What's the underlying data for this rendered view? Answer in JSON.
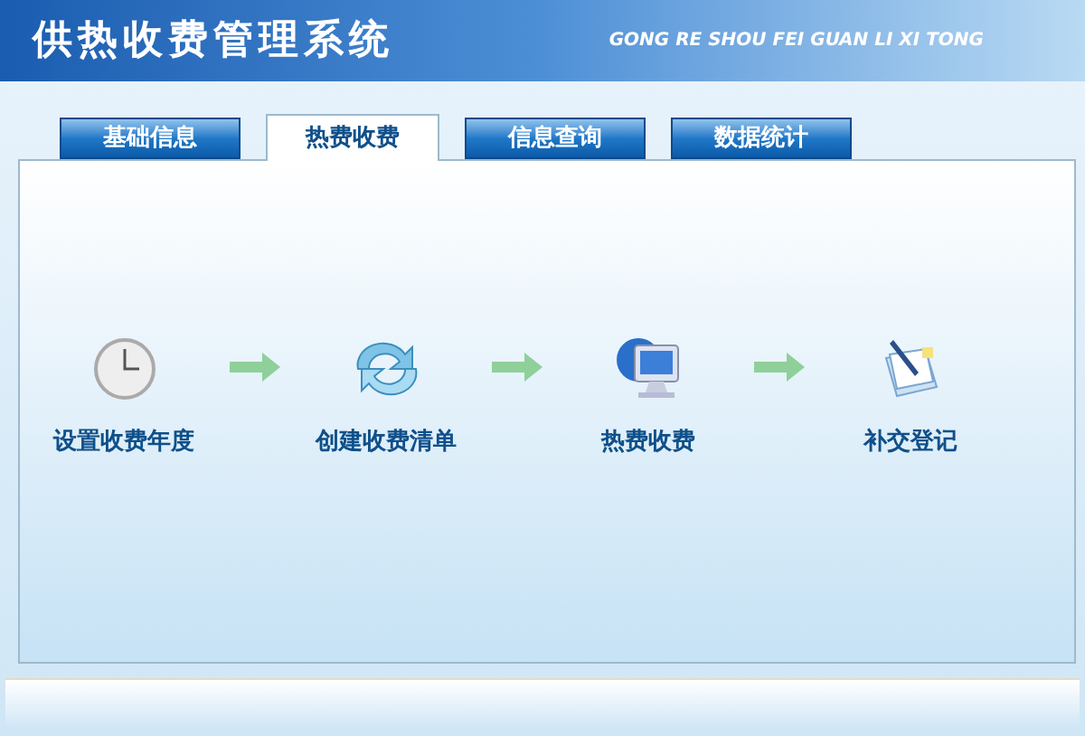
{
  "window": {
    "title": "供热收费管理系统",
    "subtitle": "GONG RE SHOU FEI GUAN LI XI TONG"
  },
  "tabs": [
    {
      "label": "基础信息",
      "selected": false
    },
    {
      "label": "热费收费",
      "selected": true
    },
    {
      "label": "信息查询",
      "selected": false
    },
    {
      "label": "数据统计",
      "selected": false
    }
  ],
  "steps": [
    {
      "label": "设置收费年度",
      "kind": "clock"
    },
    {
      "label": "创建收费清单",
      "kind": "cycle"
    },
    {
      "label": "热费收费",
      "kind": "computer"
    },
    {
      "label": "补交登记",
      "kind": "notepad"
    }
  ]
}
